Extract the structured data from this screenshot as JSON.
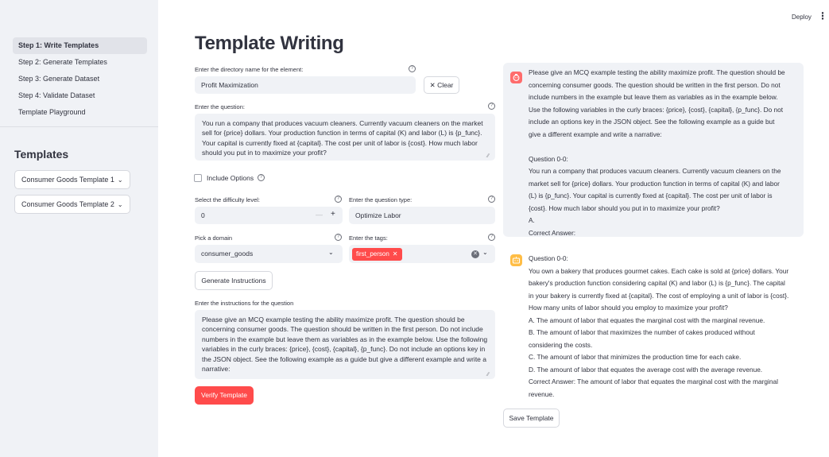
{
  "sidebar": {
    "nav": [
      {
        "label": "Step 1: Write Templates",
        "active": true
      },
      {
        "label": "Step 2: Generate Templates",
        "active": false
      },
      {
        "label": "Step 3: Generate Dataset",
        "active": false
      },
      {
        "label": "Step 4: Validate Dataset",
        "active": false
      },
      {
        "label": "Template Playground",
        "active": false
      }
    ],
    "section_title": "Templates",
    "templates": [
      {
        "label": "Consumer Goods Template 1"
      },
      {
        "label": "Consumer Goods Template 2"
      }
    ]
  },
  "header": {
    "deploy_label": "Deploy",
    "menu_icon": "kebab-menu-icon"
  },
  "main": {
    "title": "Template Writing",
    "directory": {
      "label": "Enter the directory name for the element:",
      "value": "Profit Maximization",
      "clear_label": "✕ Clear"
    },
    "question": {
      "label": "Enter the question:",
      "value": "You run a company that produces vacuum cleaners. Currently vacuum cleaners on the market sell for {price} dollars. Your production function in terms of capital (K) and labor (L) is {p_func}. Your capital is currently fixed at {capital}. The cost per unit of labor is {cost}. How much labor should you put in to maximize your profit?"
    },
    "include_options": {
      "label": "Include Options",
      "checked": false
    },
    "difficulty": {
      "label": "Select the difficulty level:",
      "value": "0",
      "minus": "—",
      "plus": "+"
    },
    "question_type": {
      "label": "Enter the question type:",
      "value": "Optimize Labor"
    },
    "domain": {
      "label": "Pick a domain",
      "value": "consumer_goods"
    },
    "tags": {
      "label": "Enter the tags:",
      "values": [
        "first_person"
      ]
    },
    "generate_button": "Generate Instructions",
    "instructions": {
      "label": "Enter the instructions for the question",
      "value": "Please give an MCQ example testing the ability maximize profit. The question should be concerning consumer goods. The question should be written in the first person. Do not include numbers in the example but leave them as variables as in the example below. Use the following variables in the curly braces: {price}, {cost}, {capital}, {p_func}. Do not include an options key in the JSON object. See the following example as a guide but give a different example and write a narrative:"
    },
    "verify_button": "Verify Template"
  },
  "chat": {
    "user_message": "Please give an MCQ example testing the ability maximize profit. The question should be\nconcerning consumer goods. The question should be written in the first person. Do not\ninclude numbers in the example but leave them as variables as in the example below.\nUse the following variables in the curly braces: {price}, {cost}, {capital}, {p_func}. Do not\ninclude an options key in the JSON object. See the following example as a guide but\ngive a different example and write a narrative:\n\nQuestion 0-0:\nYou run a company that produces vacuum cleaners. Currently vacuum cleaners on the\nmarket sell for {price} dollars. Your production function in terms of capital (K) and labor\n(L) is {p_func}. Your capital is currently fixed at {capital}. The cost per unit of labor is\n{cost}. How much labor should you put in to maximize your profit?\nA.\nCorrect Answer:",
    "assistant_message": "Question 0-0:\nYou own a bakery that produces gourmet cakes. Each cake is sold at {price} dollars. Your\nbakery's production function considering capital (K) and labor (L) is {p_func}. The capital\nin your bakery is currently fixed at {capital}. The cost of employing a unit of labor is {cost}.\nHow many units of labor should you employ to maximize your profit?\nA. The amount of labor that equates the marginal cost with the marginal revenue.\nB. The amount of labor that maximizes the number of cakes produced without\nconsidering the costs.\nC. The amount of labor that minimizes the production time for each cake.\nD. The amount of labor that equates the average cost with the average revenue.\nCorrect Answer: The amount of labor that equates the marginal cost with the marginal\nrevenue.",
    "save_button": "Save Template",
    "user_avatar_color": "#ff6c6c",
    "assistant_avatar_color": "#ffbd45"
  },
  "colors": {
    "sidebar_bg": "#f0f2f6",
    "primary": "#ff4b4b",
    "text": "#31333f"
  }
}
